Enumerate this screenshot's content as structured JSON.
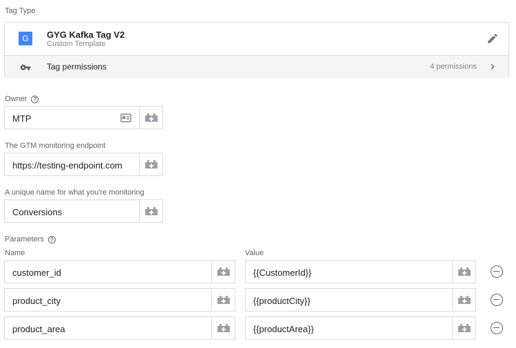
{
  "tag_type": {
    "section_label": "Tag Type",
    "name": "GYG Kafka Tag V2",
    "subtitle": "Custom Template",
    "icon_letter": "G",
    "permissions_label": "Tag permissions",
    "permissions_count": "4 permissions"
  },
  "owner": {
    "label": "Owner",
    "value": "MTP"
  },
  "endpoint": {
    "label": "The GTM monitoring endpoint",
    "value": "https://testing-endpoint.com"
  },
  "unique_name": {
    "label": "A unique name for what you're monitoring",
    "value": "Conversions"
  },
  "parameters": {
    "label": "Parameters",
    "name_header": "Name",
    "value_header": "Value",
    "rows": [
      {
        "name": "customer_id",
        "value": "{{CustomerId}}"
      },
      {
        "name": "product_city",
        "value": "{{productCity}}"
      },
      {
        "name": "product_area",
        "value": "{{productArea}}"
      }
    ]
  },
  "colors": {
    "accent": "#4285f4",
    "border": "#dadce0",
    "muted": "#5f6368"
  }
}
